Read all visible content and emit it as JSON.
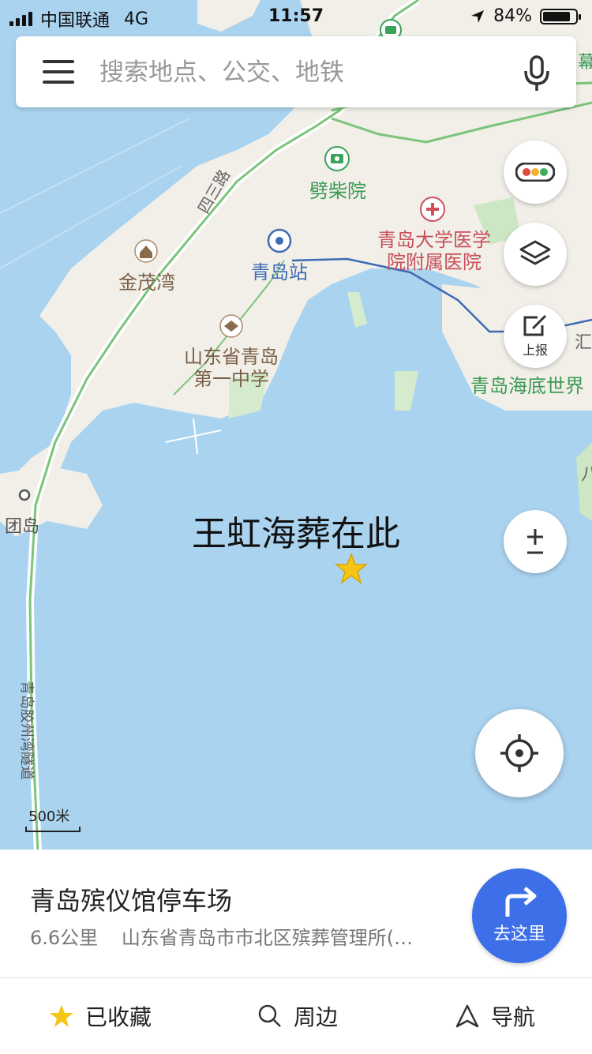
{
  "status_bar": {
    "carrier": "中国联通",
    "network": "4G",
    "time": "11:57",
    "battery_text": "84%",
    "battery_level": 0.84
  },
  "search": {
    "placeholder": "搜索地点、公交、地铁"
  },
  "map": {
    "labels": {
      "pichaiyuan": "劈柴院",
      "hospital": "青岛大学医学院附属医院",
      "station": "青岛站",
      "jinmaowan": "金茂湾",
      "school": "山东省青岛第一中学",
      "aquarium": "青岛海底世界",
      "tuandao": "团岛",
      "road_sanlu": "四三路",
      "tunnel": "青岛胶州湾隧道",
      "edge_mu": "幕",
      "edge_hui": "汇",
      "edge_ba": "八"
    },
    "marker_label": "王虹海葬在此",
    "scale_label": "500米"
  },
  "controls": {
    "report_label": "上报"
  },
  "place_panel": {
    "title": "青岛殡仪馆停车场",
    "distance": "6.6公里",
    "address": "山东省青岛市市北区殡葬管理所(…",
    "go_label": "去这里"
  },
  "tabs": {
    "saved": "已收藏",
    "nearby": "周边",
    "navigate": "导航"
  },
  "colors": {
    "water": "#aad3f0",
    "land": "#f1efe8",
    "road_green": "#7bc47b",
    "metro_blue": "#3d6bb3",
    "accent": "#3d6fe8",
    "star": "#f5c518"
  }
}
